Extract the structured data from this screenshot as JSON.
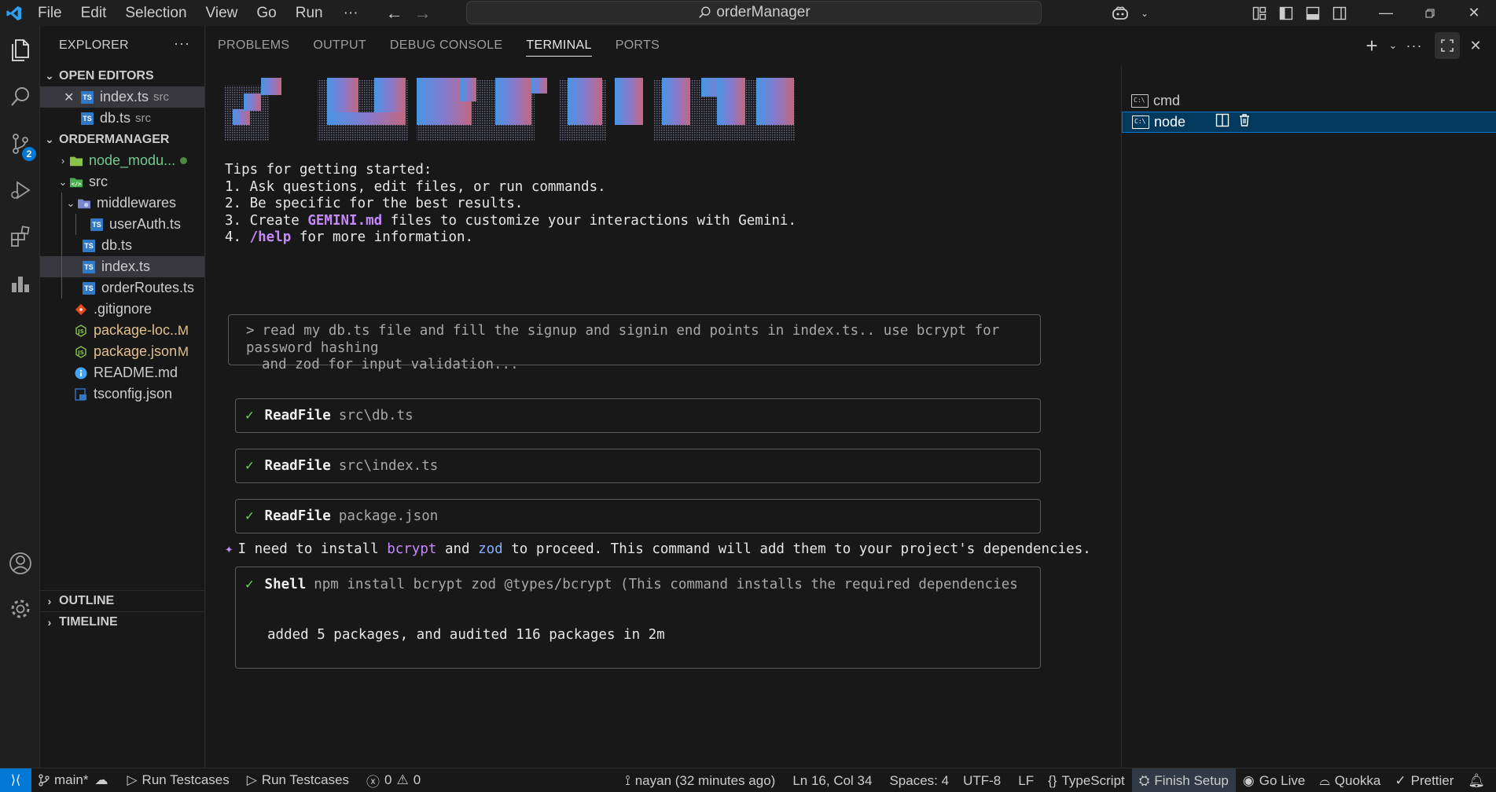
{
  "titlebar": {
    "menu": [
      "File",
      "Edit",
      "Selection",
      "View",
      "Go",
      "Run",
      "···"
    ],
    "search_text": "orderManager",
    "accent": "#0078d4"
  },
  "activity": {
    "scm_badge": "2"
  },
  "sidebar": {
    "title": "EXPLORER",
    "open_editors_label": "OPEN EDITORS",
    "open_editors": [
      {
        "name": "index.ts",
        "desc": "src"
      },
      {
        "name": "db.ts",
        "desc": "src"
      }
    ],
    "project_label": "ORDERMANAGER",
    "tree": {
      "node_modules": "node_modu...",
      "src": "src",
      "middlewares": "middlewares",
      "userAuth": "userAuth.ts",
      "db": "db.ts",
      "index": "index.ts",
      "orderRoutes": "orderRoutes.ts",
      "gitignore": ".gitignore",
      "package_lock": "package-loc...",
      "package_lock_status": "M",
      "package_json": "package.json",
      "package_json_status": "M",
      "readme": "README.md",
      "tsconfig": "tsconfig.json"
    },
    "outline_label": "OUTLINE",
    "timeline_label": "TIMELINE"
  },
  "panel": {
    "tabs": [
      "PROBLEMS",
      "OUTPUT",
      "DEBUG CONSOLE",
      "TERMINAL",
      "PORTS"
    ],
    "active_tab": "TERMINAL",
    "terminal": {
      "tips_title": "Tips for getting started:",
      "tip1": "1. Ask questions, edit files, or run commands.",
      "tip2": "2. Be specific for the best results.",
      "tip3_pre": "3. Create ",
      "tip3_hl": "GEMINI.md",
      "tip3_post": " files to customize your interactions with Gemini.",
      "tip4_pre": "4. ",
      "tip4_hl": "/help",
      "tip4_post": " for more information.",
      "prompt_marker": ">",
      "prompt_line1": "read my db.ts file and fill the signup and signin end points in index.ts.. use bcrypt for password hashing",
      "prompt_line2": "and zod for input validation...",
      "check": "✓",
      "tools": [
        {
          "name": "ReadFile",
          "arg": "src\\db.ts"
        },
        {
          "name": "ReadFile",
          "arg": "src\\index.ts"
        },
        {
          "name": "ReadFile",
          "arg": "package.json"
        }
      ],
      "msg_sparkle": "✦",
      "msg_pre": "I need to install ",
      "msg_hl1": "bcrypt",
      "msg_mid": " and ",
      "msg_hl2": "zod",
      "msg_post": " to proceed. This command will add them to your project's dependencies.",
      "shell_name": "Shell",
      "shell_cmd": "npm install bcrypt zod @types/bcrypt (This command installs the required dependencies `bcrypt` and …",
      "shell_output": "added 5 packages, and audited 116 packages in 2m"
    },
    "terminals": [
      {
        "name": "cmd"
      },
      {
        "name": "node"
      }
    ]
  },
  "statusbar": {
    "branch": "main*",
    "run1": "Run Testcases",
    "run2": "Run Testcases",
    "errors": "0",
    "warnings": "0",
    "blame": "nayan (32 minutes ago)",
    "position": "Ln 16, Col 34",
    "spaces": "Spaces: 4",
    "encoding": "UTF-8",
    "eol": "LF",
    "language": "TypeScript",
    "finish": "Finish Setup",
    "golive": "Go Live",
    "quokka": "Quokka",
    "prettier": "Prettier"
  }
}
